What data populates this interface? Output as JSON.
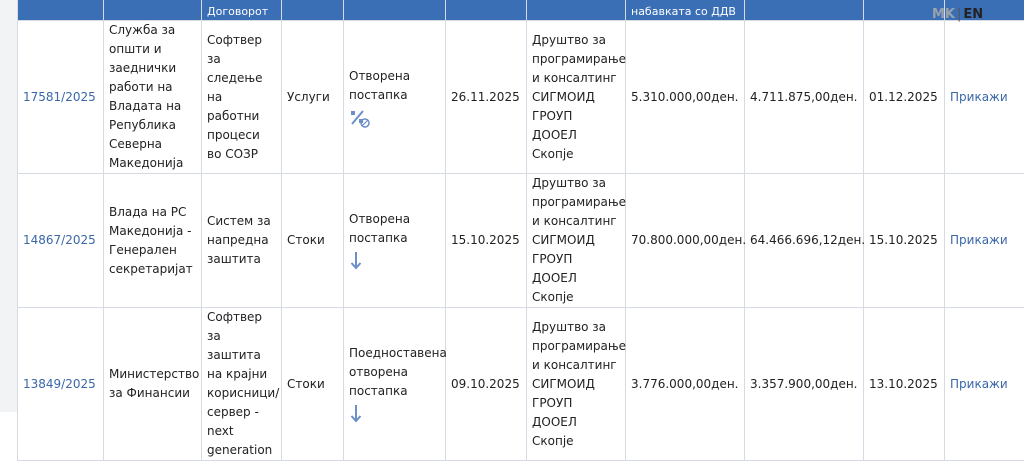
{
  "header": {
    "col_contract_partial": "Договорот",
    "col_value_partial": "набавката со ДДВ"
  },
  "lang": {
    "mk": "MK",
    "sep": "|",
    "en": "EN"
  },
  "rows": [
    {
      "number": "17581/2025",
      "institution": "Служба за општи и заеднички работи на Владата на Република Северна Македонија",
      "subject": "Софтвер за следење на работни процеси во СОЗР",
      "type": "Услуги",
      "procedure": "Отворена постапка",
      "status_icon": "percent-icon",
      "date1": "26.11.2025",
      "supplier": "Друштво за програмирање и консалтинг СИГМОИД ГРОУП ДООЕЛ Скопје",
      "value": "5.310.000,00ден.",
      "value2": "4.711.875,00ден.",
      "date2": "01.12.2025",
      "link": "Прикажи"
    },
    {
      "number": "14867/2025",
      "institution": "Влада на РС Македонија - Генерален секретаријат",
      "subject": "Систем за напредна заштита",
      "type": "Стоки",
      "procedure": "Отворена постапка",
      "status_icon": "arrow-down-icon",
      "date1": "15.10.2025",
      "supplier": "Друштво за програмирање и консалтинг СИГМОИД ГРОУП ДООЕЛ Скопје",
      "value": "70.800.000,00ден.",
      "value2": "64.466.696,12ден.",
      "date2": "15.10.2025",
      "link": "Прикажи"
    },
    {
      "number": "13849/2025",
      "institution": "Министерство за Финансии",
      "subject": "Софтвер за заштита на крајни корисници/ сервер - next generation",
      "type": "Стоки",
      "procedure": "Поедноставена отворена постапка",
      "status_icon": "arrow-down-icon",
      "date1": "09.10.2025",
      "supplier": "Друштво за програмирање и консалтинг СИГМОИД ГРОУП ДООЕЛ Скопје",
      "value": "3.776.000,00ден.",
      "value2": "3.357.900,00ден.",
      "date2": "13.10.2025",
      "link": "Прикажи"
    }
  ],
  "colors": {
    "header_bg": "#3b6fb5",
    "link": "#3a67a8",
    "border": "#d6dbe3"
  }
}
